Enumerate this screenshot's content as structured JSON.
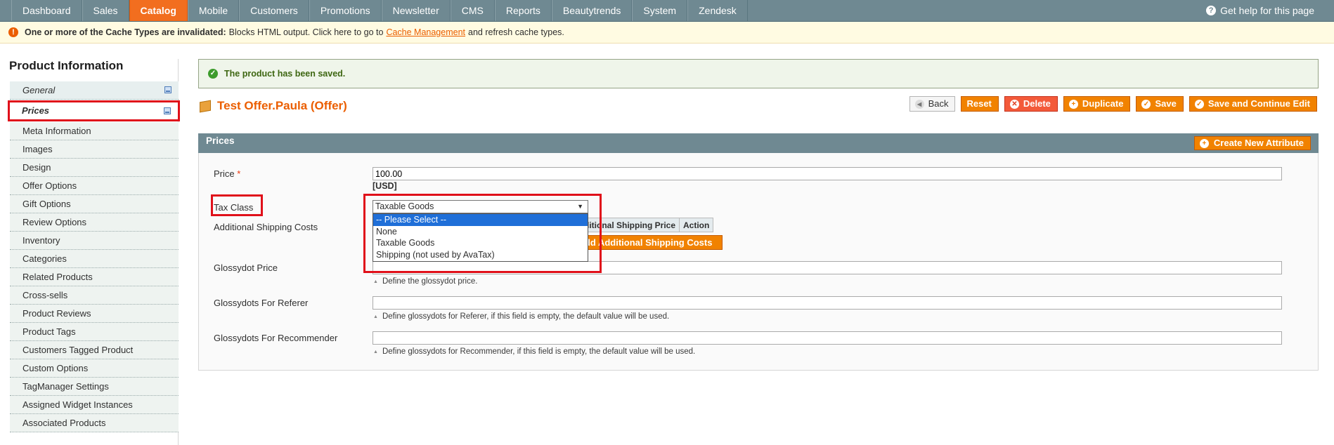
{
  "nav": {
    "items": [
      "Dashboard",
      "Sales",
      "Catalog",
      "Mobile",
      "Customers",
      "Promotions",
      "Newsletter",
      "CMS",
      "Reports",
      "Beautytrends",
      "System",
      "Zendesk"
    ],
    "help": "Get help for this page"
  },
  "notice": {
    "bold": "One or more of the Cache Types are invalidated:",
    "text1": "Blocks HTML output. Click here to go to",
    "link": "Cache Management",
    "text2": "and refresh cache types."
  },
  "sidebar": {
    "title": "Product Information",
    "items": [
      "General",
      "Prices",
      "Meta Information",
      "Images",
      "Design",
      "Offer Options",
      "Gift Options",
      "Review Options",
      "Inventory",
      "Categories",
      "Related Products",
      "Cross-sells",
      "Product Reviews",
      "Product Tags",
      "Customers Tagged Product",
      "Custom Options",
      "TagManager Settings",
      "Assigned Widget Instances",
      "Associated Products"
    ]
  },
  "success_message": "The product has been saved.",
  "product_title": "Test Offer.Paula (Offer)",
  "buttons": {
    "back": "Back",
    "reset": "Reset",
    "delete": "Delete",
    "duplicate": "Duplicate",
    "save": "Save",
    "save_continue": "Save and Continue Edit",
    "create_attribute": "Create New Attribute",
    "add_shipping": "Add Additional Shipping Costs"
  },
  "section": {
    "title": "Prices",
    "price_label": "Price",
    "required_mark": "*",
    "price_value": "100.00",
    "currency": "[USD]",
    "tax_label": "Tax Class",
    "tax_selected": "Taxable Goods",
    "tax_options": [
      "-- Please Select --",
      "None",
      "Taxable Goods",
      "Shipping (not used by AvaTax)"
    ],
    "shipping_label": "Additional Shipping Costs",
    "shipping_columns": [
      "Additional Shipping Price",
      "Action"
    ],
    "glossydot_label": "Glossydot Price",
    "glossydot_hint": "Define the glossydot price.",
    "referer_label": "Glossydots For Referer",
    "referer_hint": "Define glossydots for Referer, if this field is empty, the default value will be used.",
    "recommender_label": "Glossydots For Recommender",
    "recommender_hint": "Define glossydots for Recommender, if this field is empty, the default value will be used."
  },
  "colors": {
    "header": "#6f8992",
    "accent": "#f18200",
    "highlight": "#e0101a"
  }
}
